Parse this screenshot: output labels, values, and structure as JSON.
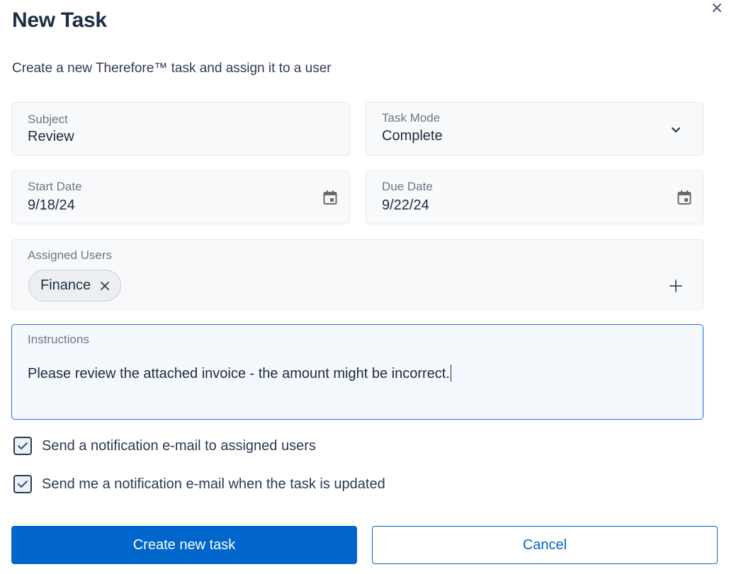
{
  "dialog": {
    "title": "New Task",
    "subtitle": "Create a new Therefore™ task and assign it to a user",
    "close_icon": "close-icon"
  },
  "fields": {
    "subject": {
      "label": "Subject",
      "value": "Review"
    },
    "task_mode": {
      "label": "Task Mode",
      "value": "Complete",
      "icon": "chevron-down-icon"
    },
    "start_date": {
      "label": "Start Date",
      "value": "9/18/24",
      "icon": "calendar-icon"
    },
    "due_date": {
      "label": "Due Date",
      "value": "9/22/24",
      "icon": "calendar-icon"
    },
    "assigned_users": {
      "label": "Assigned Users",
      "chips": [
        {
          "label": "Finance"
        }
      ],
      "add_icon": "plus-icon"
    },
    "instructions": {
      "label": "Instructions",
      "value": "Please review the attached invoice - the amount might be incorrect."
    }
  },
  "options": [
    {
      "label": "Send a notification e-mail to assigned users",
      "checked": true
    },
    {
      "label": "Send me a notification e-mail when the task is updated",
      "checked": true
    }
  ],
  "buttons": {
    "create": "Create new task",
    "cancel": "Cancel"
  },
  "colors": {
    "primary": "#0066cc",
    "focus_border": "#1a73d9",
    "title": "#1d2e45"
  }
}
